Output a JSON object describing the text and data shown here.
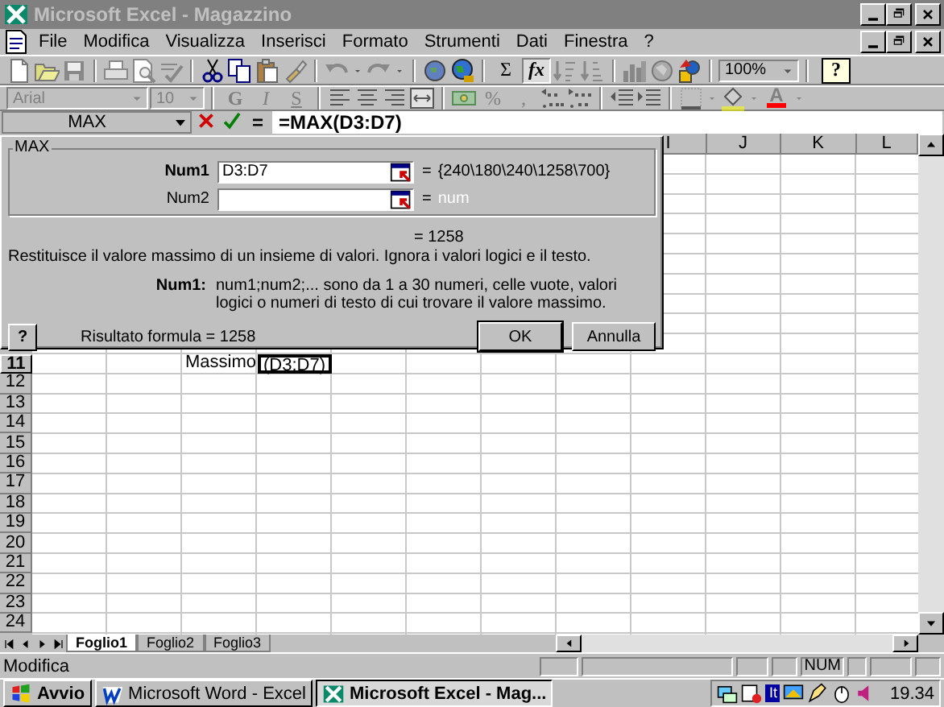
{
  "window": {
    "title": "Microsoft Excel - Magazzino",
    "active": false
  },
  "menu": [
    "File",
    "Modifica",
    "Visualizza",
    "Inserisci",
    "Formato",
    "Strumenti",
    "Dati",
    "Finestra",
    "?"
  ],
  "standard_toolbar": {
    "buttons": [
      {
        "label": "Σ",
        "pressed": false
      },
      {
        "label": "fx",
        "pressed": true
      }
    ],
    "zoom": "100%",
    "help": "?"
  },
  "formatting_toolbar": {
    "disabled": true,
    "font": "Arial",
    "size": "10",
    "buttons": [
      {
        "label": "G"
      },
      {
        "label": "I"
      },
      {
        "label": "S"
      },
      {
        "label": "%"
      },
      {
        "label": ","
      }
    ],
    "font_color": "A"
  },
  "formula_bar": {
    "name_box": "MAX",
    "equals": "=",
    "formula": "=MAX(D3:D7)"
  },
  "sheet": {
    "columns": [
      "I",
      "J",
      "K",
      "L"
    ],
    "rows": [
      {
        "number": "11",
        "selected": true,
        "cells": [
          {
            "text": "Massimo",
            "selected": false
          },
          {
            "text": "(D3:D7)",
            "selected": true
          }
        ]
      },
      {
        "number": "12",
        "selected": false
      },
      {
        "number": "13",
        "selected": false
      },
      {
        "number": "14",
        "selected": false
      },
      {
        "number": "15",
        "selected": false
      },
      {
        "number": "16",
        "selected": false
      },
      {
        "number": "17",
        "selected": false
      },
      {
        "number": "18",
        "selected": false
      },
      {
        "number": "19",
        "selected": false
      },
      {
        "number": "20",
        "selected": false
      },
      {
        "number": "21",
        "selected": false
      },
      {
        "number": "22",
        "selected": false
      },
      {
        "number": "23",
        "selected": false
      },
      {
        "number": "24",
        "selected": false
      }
    ]
  },
  "dialog": {
    "group_title": "MAX",
    "arguments": [
      {
        "label": "Num1",
        "value": "D3:D7",
        "sign": "=",
        "result": "{240\\180\\240\\1258\\700}",
        "focused": true,
        "filled": true
      },
      {
        "label": "Num2",
        "sign": "=",
        "result": "num",
        "focused": false,
        "filled": false
      }
    ],
    "value": "= 1258",
    "description": "Restituisce il valore massimo di un insieme di valori. Ignora i valori logici e il testo.",
    "help_label": "Num1:",
    "help_text": "num1;num2;... sono da 1 a 30 numeri, celle vuote, valori logici o numeri di testo di cui trovare il valore massimo.",
    "help_button": "?",
    "result": "Risultato formula = 1258",
    "buttons": [
      {
        "label": "OK",
        "default": true
      },
      {
        "label": "Annulla",
        "default": false
      }
    ]
  },
  "sheet_tabs": [
    {
      "label": "Foglio1",
      "selected": true
    },
    {
      "label": "Foglio2",
      "selected": false
    },
    {
      "label": "Foglio3",
      "selected": false
    }
  ],
  "status_bar": {
    "message": "Modifica",
    "indicator": "NUM"
  },
  "taskbar": {
    "start": "Avvio",
    "tasks": [
      {
        "label": "Microsoft Word - Excel",
        "selected": false,
        "kind": "word"
      },
      {
        "label": "Microsoft Excel - Mag...",
        "selected": true,
        "kind": "excel"
      }
    ],
    "language": "It",
    "clock": "19.34"
  }
}
